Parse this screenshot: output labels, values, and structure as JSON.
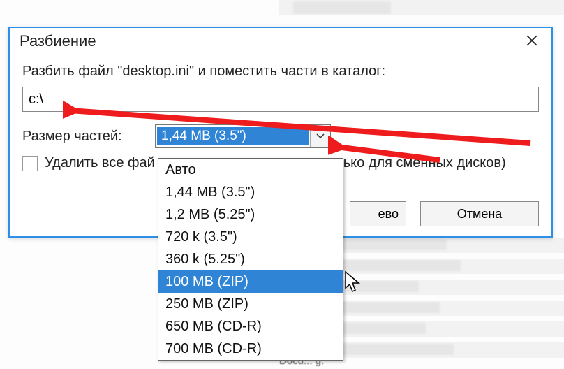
{
  "dialog": {
    "title": "Разбиение",
    "instruction": "Разбить файл \"desktop.ini\" и поместить части в каталог:",
    "path_value": "c:\\",
    "size_label": "Размер частей:",
    "size_selected": "1,44 MB (3.5\")",
    "delete_label_a": "Удалить все фай",
    "delete_label_b": "ько для сменных дисков)",
    "ok_suffix": "ево",
    "cancel": "Отмена"
  },
  "dropdown": {
    "options": [
      "Авто",
      "1,44 MB (3.5\")",
      "1,2 MB (5.25\")",
      "720 k (3.5\")",
      "360 k (5.25\")",
      "100 MB (ZIP)",
      "250 MB (ZIP)",
      "650 MB (CD-R)",
      "700 MB (CD-R)"
    ],
    "selected_index": 5
  },
  "icons": {
    "close": "close-icon",
    "caret": "chevron-down-icon",
    "cursor": "mouse-cursor"
  }
}
